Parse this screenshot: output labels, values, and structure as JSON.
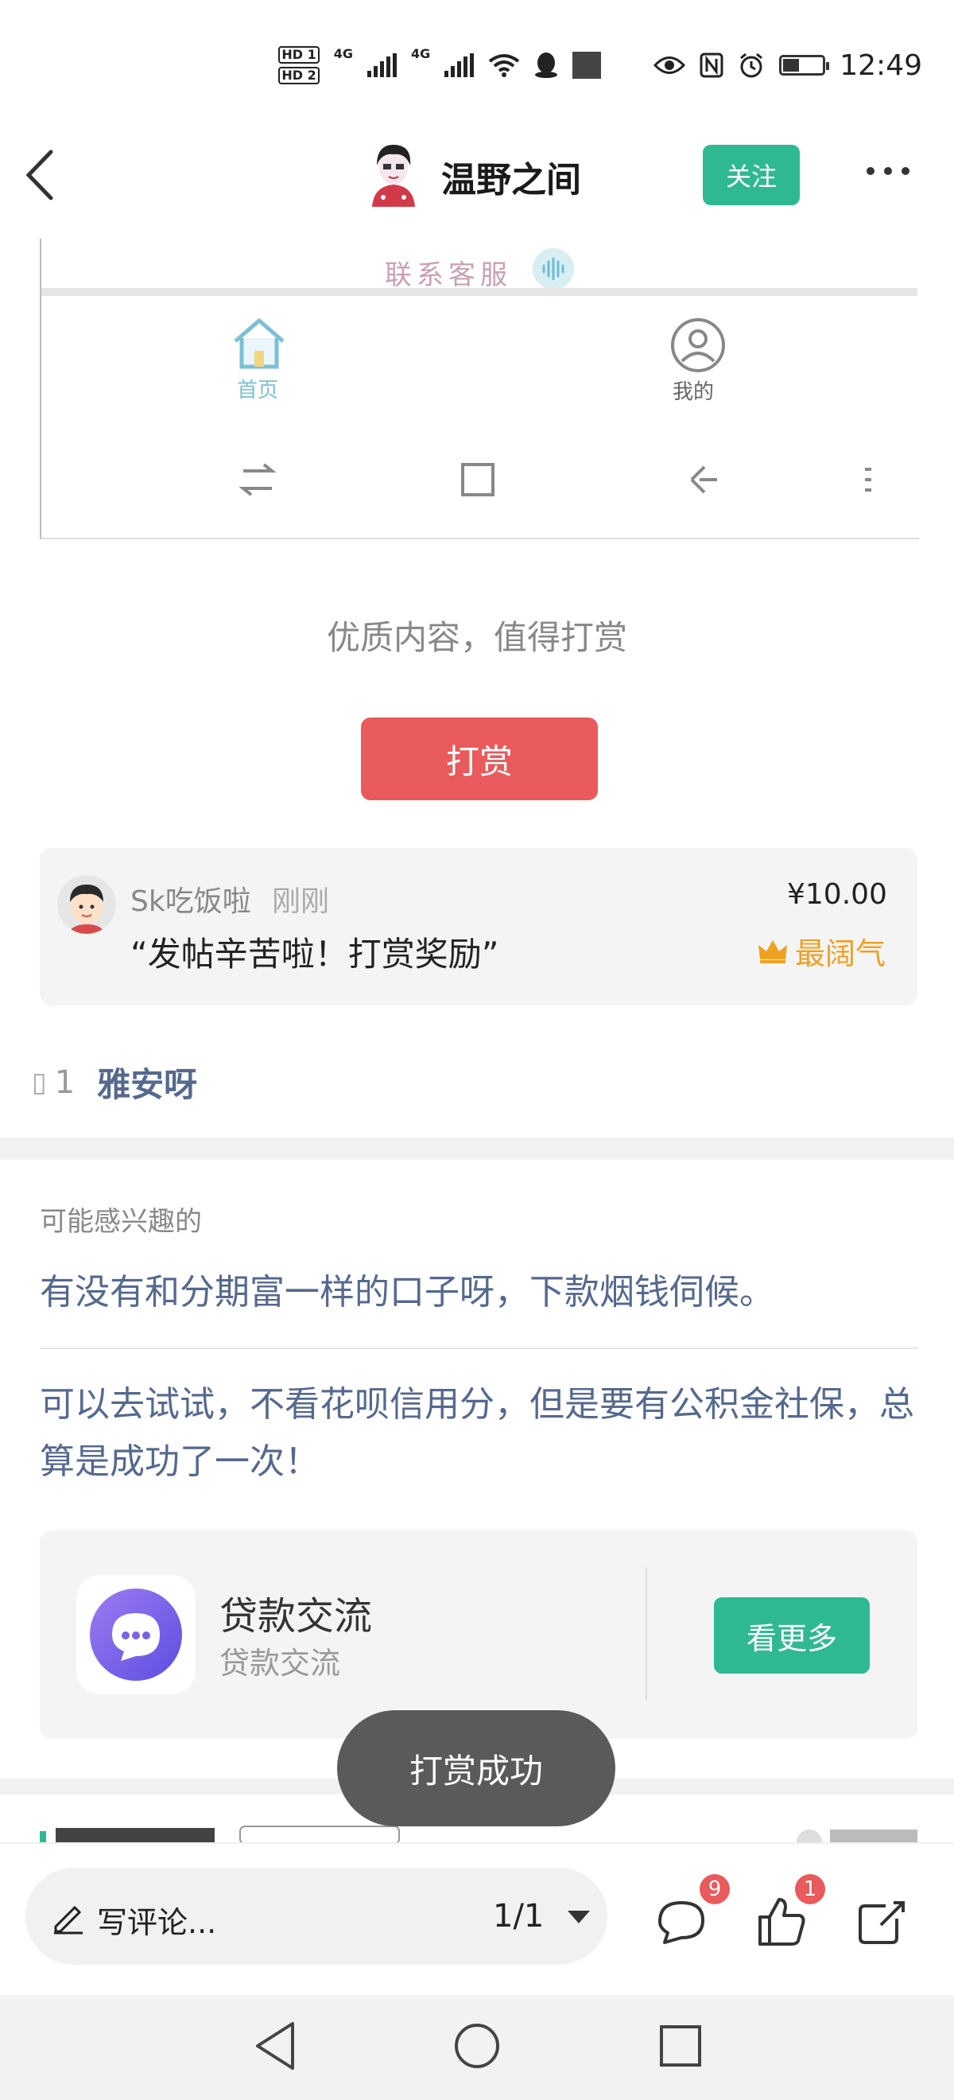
{
  "status_bar": {
    "time": "12:49",
    "hd1": "HD 1",
    "hd2": "HD 2",
    "net1": "4G",
    "net2": "4G"
  },
  "header": {
    "title": "温野之间",
    "follow_label": "关注"
  },
  "embedded": {
    "customer_service": "联系客服",
    "home_label": "首页",
    "me_label": "我的"
  },
  "reward": {
    "prompt": "优质内容，值得打赏",
    "button_label": "打赏",
    "record": {
      "user": "Sk吃饭啦",
      "time": "刚刚",
      "message": "“发帖辛苦啦！打赏奖励”",
      "amount": "¥10.00",
      "badge": "最阔气"
    }
  },
  "likes": {
    "count": "1",
    "user": "雅安呀"
  },
  "interest": {
    "heading": "可能感兴趣的",
    "items": [
      "有没有和分期富一样的口子呀，下款烟钱伺候。",
      "可以去试试，不看花呗信用分，但是要有公积金社保，总算是成功了一次！"
    ],
    "group": {
      "title": "贷款交流",
      "subtitle": "贷款交流",
      "button_label": "看更多"
    }
  },
  "toast": "打赏成功",
  "bottom_bar": {
    "comment_placeholder": "写评论...",
    "page_indicator": "1/1",
    "comment_badge": "9",
    "like_badge": "1"
  },
  "colors": {
    "accent_green": "#2fb992",
    "reward_red": "#e85a5b",
    "link_blue": "#55698e",
    "gold": "#f0a020"
  }
}
